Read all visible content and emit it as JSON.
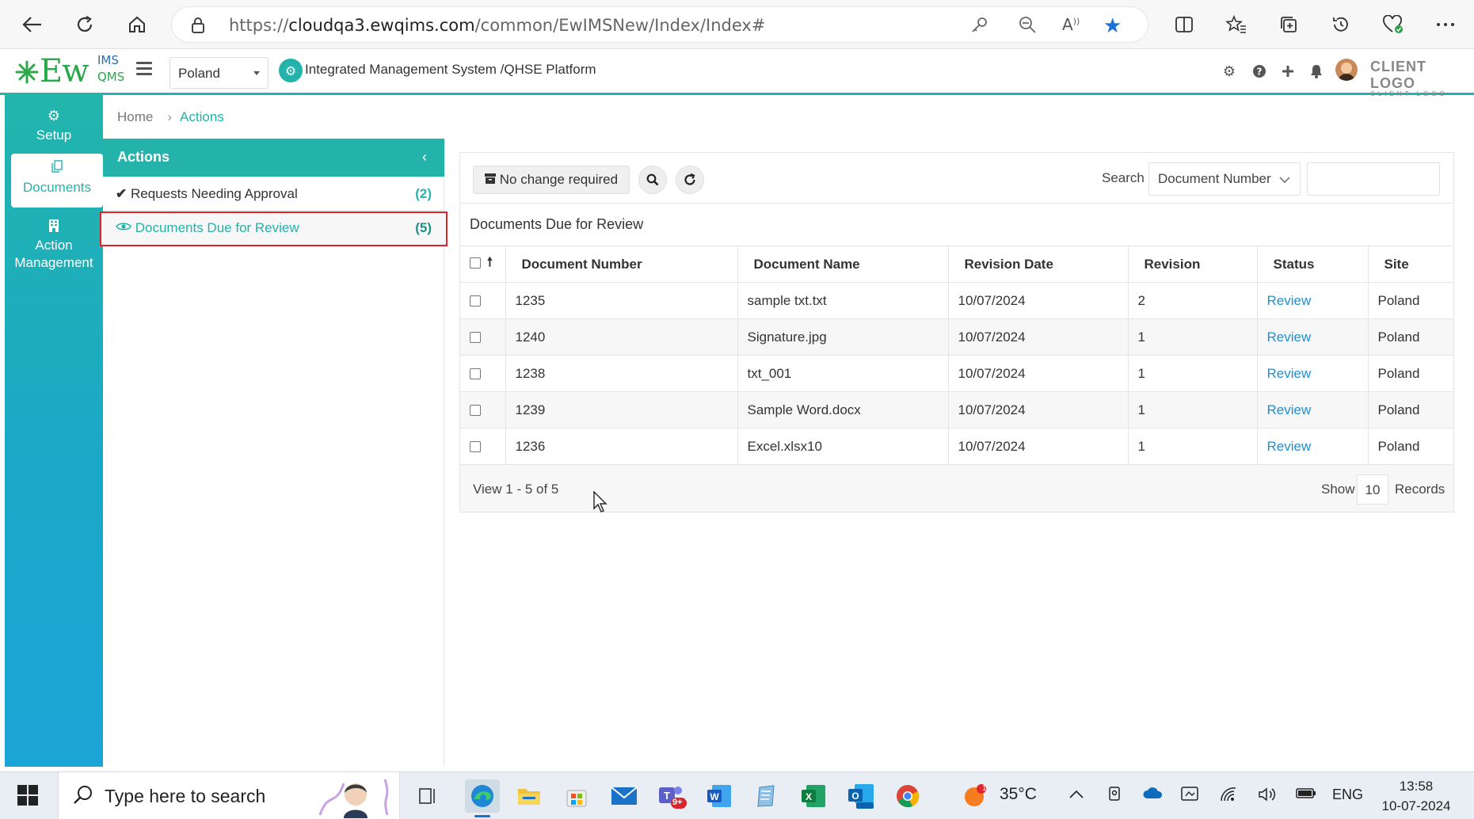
{
  "browser": {
    "url_prefix": "https://",
    "url_host": "cloudqa3.ewqims.com",
    "url_path": "/common/EwIMSNew/Index/Index#"
  },
  "header": {
    "logo_text": "Ew",
    "logo_sup_top": "IMS",
    "logo_sup_bottom": "QMS",
    "country": "Poland",
    "platform_title": "Integrated Management System /QHSE Platform",
    "client_logo": "CLIENT LOGO",
    "client_logo_sub": "CLIENT LOGO"
  },
  "left_nav": {
    "items": [
      {
        "label": "Setup",
        "icon": "gears-icon"
      },
      {
        "label": "Documents",
        "icon": "documents-icon"
      },
      {
        "label": "Action Management",
        "icon": "building-icon"
      }
    ]
  },
  "breadcrumb": {
    "home": "Home",
    "current": "Actions"
  },
  "actions_panel": {
    "title": "Actions",
    "items": [
      {
        "label": "Requests Needing Approval",
        "count": "(2)"
      },
      {
        "label": "Documents Due for Review",
        "count": "(5)"
      }
    ]
  },
  "toolbar": {
    "no_change_label": "No change required",
    "search_label": "Search",
    "search_field": "Document Number",
    "search_value": ""
  },
  "grid": {
    "title": "Documents Due for Review",
    "columns": [
      "Document Number",
      "Document Name",
      "Revision Date",
      "Revision",
      "Status",
      "Site"
    ],
    "rows": [
      {
        "number": "1235",
        "name": "sample txt.txt",
        "date": "10/07/2024",
        "revision": "2",
        "status": "Review",
        "site": "Poland"
      },
      {
        "number": "1240",
        "name": "Signature.jpg",
        "date": "10/07/2024",
        "revision": "1",
        "status": "Review",
        "site": "Poland"
      },
      {
        "number": "1238",
        "name": "txt_001",
        "date": "10/07/2024",
        "revision": "1",
        "status": "Review",
        "site": "Poland"
      },
      {
        "number": "1239",
        "name": "Sample Word.docx",
        "date": "10/07/2024",
        "revision": "1",
        "status": "Review",
        "site": "Poland"
      },
      {
        "number": "1236",
        "name": "Excel.xlsx10",
        "date": "10/07/2024",
        "revision": "1",
        "status": "Review",
        "site": "Poland"
      }
    ],
    "footer_view": "View 1 - 5 of 5",
    "footer_show": "Show",
    "page_size": "10",
    "footer_records": "Records"
  },
  "taskbar": {
    "search_placeholder": "Type here to search",
    "weather": "35°C",
    "weather_badge": "1",
    "teams_badge": "9+",
    "language": "ENG",
    "time": "13:58",
    "date": "10-07-2024"
  },
  "colors": {
    "accent": "#24b3ab",
    "link": "#1f8fd1",
    "highlight_border": "#d9262c"
  }
}
